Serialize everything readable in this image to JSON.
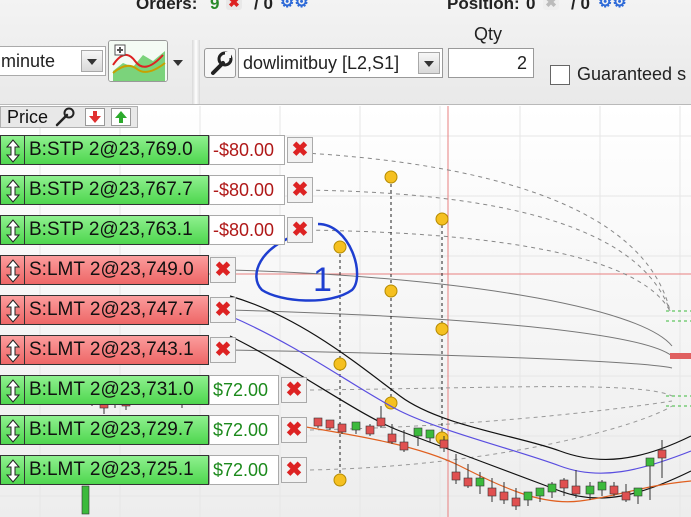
{
  "header": {
    "orders_label": "Orders:",
    "orders_count": "9",
    "orders_secondary": "/ 0",
    "position_label": "Position:",
    "position_count": "0",
    "position_secondary": "/ 0",
    "interval_value": "minute",
    "strategy_value": "dowlimitbuy [L2,S1]",
    "qty_label": "Qty",
    "qty_value": "2",
    "guaranteed_label": "Guaranteed s"
  },
  "price_panel": {
    "label": "Price"
  },
  "orders": [
    {
      "side": "buy",
      "label": "B:STP 2@23,769.0",
      "pnl": "-$80.00",
      "pnl_color": "#b01818"
    },
    {
      "side": "buy",
      "label": "B:STP 2@23,767.7",
      "pnl": "-$80.00",
      "pnl_color": "#b01818"
    },
    {
      "side": "buy",
      "label": "B:STP 2@23,763.1",
      "pnl": "-$80.00",
      "pnl_color": "#b01818"
    },
    {
      "side": "sell",
      "label": "S:LMT 2@23,749.0",
      "pnl": ""
    },
    {
      "side": "sell",
      "label": "S:LMT 2@23,747.7",
      "pnl": ""
    },
    {
      "side": "sell",
      "label": "S:LMT 2@23,743.1",
      "pnl": ""
    },
    {
      "side": "buy",
      "label": "B:LMT 2@23,731.0",
      "pnl": "$72.00",
      "pnl_color": "#1c8a1c"
    },
    {
      "side": "buy",
      "label": "B:LMT 2@23,729.7",
      "pnl": "$72.00",
      "pnl_color": "#1c8a1c"
    },
    {
      "side": "buy",
      "label": "B:LMT 2@23,725.1",
      "pnl": "$72.00",
      "pnl_color": "#1c8a1c"
    }
  ],
  "annotations": {
    "handwritten_number": "1"
  },
  "colors": {
    "buy": "#4ed64e",
    "sell": "#ee6666",
    "crosshair": "#e88080",
    "candle_up": "#3cba3c",
    "candle_down": "#e05050",
    "handle": "#f5c020",
    "ink": "#1e3ed0"
  }
}
